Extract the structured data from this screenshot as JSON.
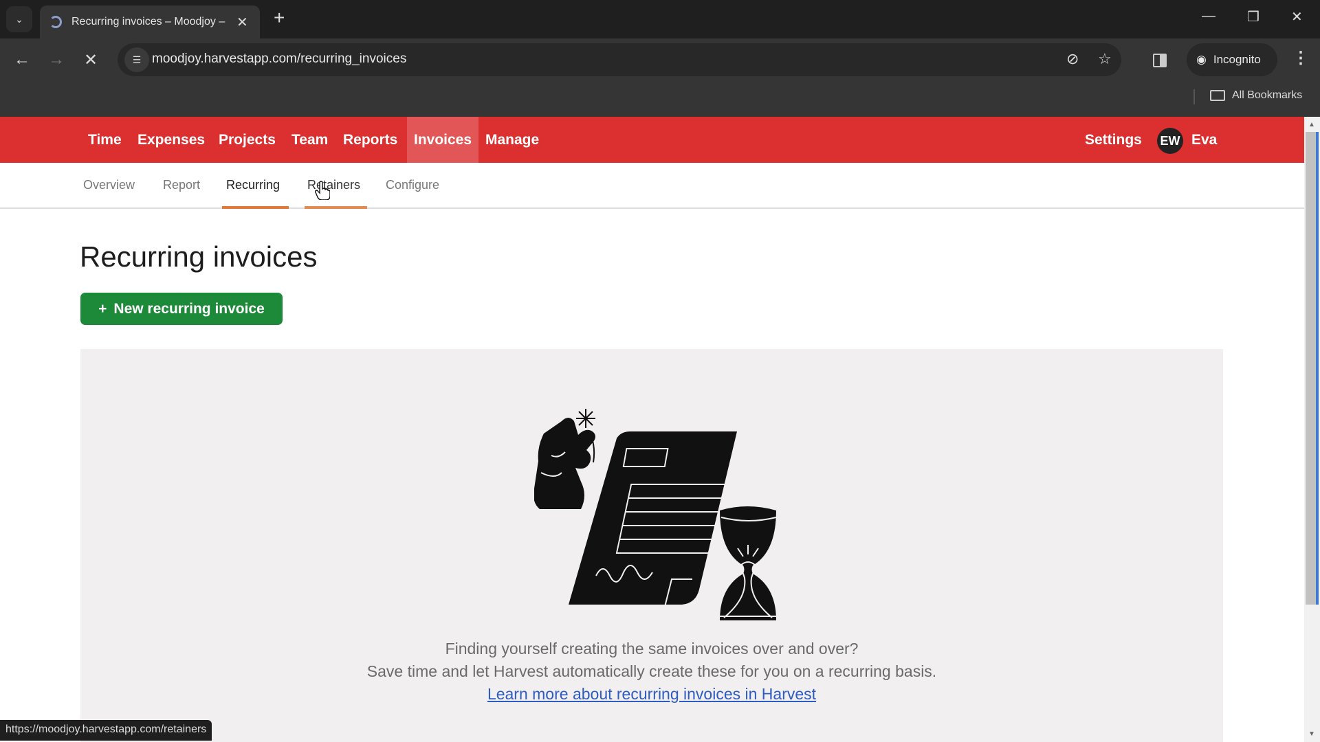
{
  "browser": {
    "tab_title": "Recurring invoices – Moodjoy –",
    "url": "moodjoy.harvestapp.com/recurring_invoices",
    "incognito_label": "Incognito",
    "bookmarks_label": "All Bookmarks",
    "status_url": "https://moodjoy.harvestapp.com/retainers"
  },
  "app_nav": {
    "items": [
      {
        "label": "Time",
        "active": false
      },
      {
        "label": "Expenses",
        "active": false
      },
      {
        "label": "Projects",
        "active": false
      },
      {
        "label": "Team",
        "active": false
      },
      {
        "label": "Reports",
        "active": false
      },
      {
        "label": "Invoices",
        "active": true
      },
      {
        "label": "Manage",
        "active": false
      }
    ],
    "settings_label": "Settings",
    "user_initials": "EW",
    "user_name": "Eva",
    "brand_color": "#db2f30"
  },
  "sub_nav": {
    "items": [
      {
        "label": "Overview",
        "active": false
      },
      {
        "label": "Report",
        "active": false
      },
      {
        "label": "Recurring",
        "active": true
      },
      {
        "label": "Retainers",
        "active": false,
        "hovered": true
      },
      {
        "label": "Configure",
        "active": false
      }
    ]
  },
  "main": {
    "title": "Recurring invoices",
    "new_button_label": "New recurring invoice",
    "new_button_color": "#1d8a3a",
    "empty_state": {
      "line1": "Finding yourself creating the same invoices over and over?",
      "line2": "Save time and let Harvest automatically create these for you on a recurring basis.",
      "link_text": "Learn more about recurring invoices in Harvest"
    }
  }
}
